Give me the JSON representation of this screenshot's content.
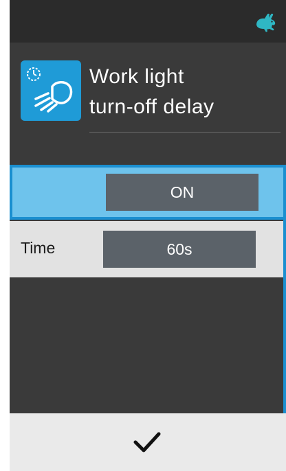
{
  "header": {
    "title_line1": "Work light",
    "title_line2": "turn-off delay",
    "icon": "work-light-timer-icon"
  },
  "status": {
    "icon": "rabbit-speed-icon",
    "icon_color": "#2fb7c4"
  },
  "settings": [
    {
      "label": "",
      "value": "ON",
      "selected": true
    },
    {
      "label": "Time",
      "value": "60s",
      "selected": false
    }
  ],
  "footer": {
    "confirm_icon": "checkmark-icon"
  },
  "colors": {
    "accent": "#1b8fd0",
    "selected_row": "#6ec3ec",
    "value_box": "#5b6269",
    "background": "#3a3a3a"
  }
}
